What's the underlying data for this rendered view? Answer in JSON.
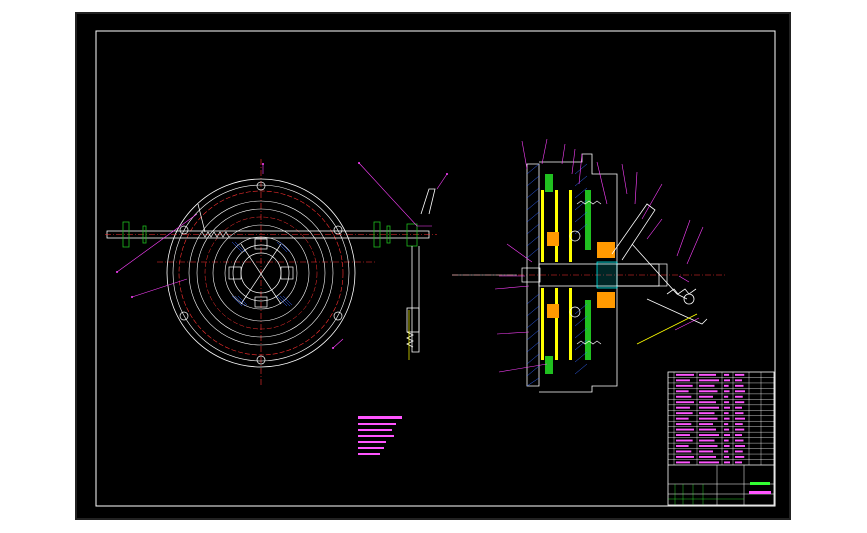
{
  "colors": {
    "background": "#000000",
    "frame": "#ffffff",
    "outline": "#ffffff",
    "centerline": "#ff3030",
    "hatch": "#3366ff",
    "leader": "#ff40ff",
    "part_green": "#20c020",
    "part_yellow": "#ffff00",
    "part_cyan": "#00ffff",
    "part_orange": "#ff9900"
  },
  "views": [
    {
      "name": "end-view"
    },
    {
      "name": "section-view"
    }
  ],
  "title_block": {
    "rows": 17
  }
}
